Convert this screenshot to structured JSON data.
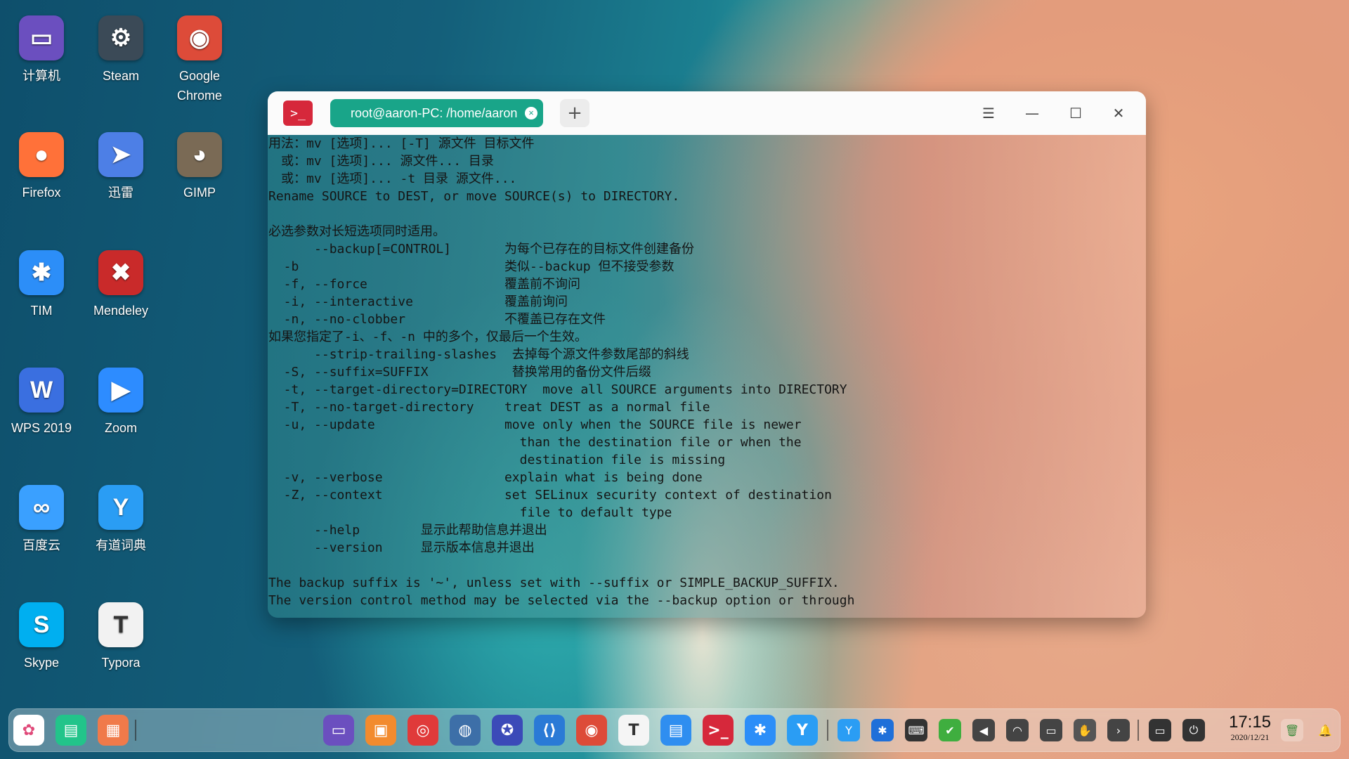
{
  "desktop": {
    "icons": [
      {
        "label": "计算机",
        "glyph": "▭",
        "color": "#6b4fbf",
        "icon": "computer-icon"
      },
      {
        "label": "Steam",
        "glyph": "⚙",
        "color": "#3b4a57",
        "icon": "steam-icon"
      },
      {
        "label": "Google Chrome",
        "glyph": "◉",
        "color": "#dd4b39",
        "icon": "chrome-icon"
      },
      {
        "label": "Firefox",
        "glyph": "●",
        "color": "#ff7139",
        "icon": "firefox-icon"
      },
      {
        "label": "迅雷",
        "glyph": "➤",
        "color": "#4d7fe6",
        "icon": "xunlei-icon"
      },
      {
        "label": "GIMP",
        "glyph": "◕",
        "color": "#7a6a55",
        "icon": "gimp-icon"
      },
      {
        "label": "TIM",
        "glyph": "✱",
        "color": "#2c8ef8",
        "icon": "tim-icon"
      },
      {
        "label": "Mendeley",
        "glyph": "✖",
        "color": "#c92a2a",
        "icon": "mendeley-icon"
      },
      {
        "label": "WPS 2019",
        "glyph": "W",
        "color": "#3a6fe0",
        "icon": "wps-icon"
      },
      {
        "label": "Zoom",
        "glyph": "▶",
        "color": "#2d8cff",
        "icon": "zoom-icon"
      },
      {
        "label": "百度云",
        "glyph": "∞",
        "color": "#3aa0ff",
        "icon": "baidu-cloud-icon"
      },
      {
        "label": "有道词典",
        "glyph": "Y",
        "color": "#2a9df4",
        "icon": "youdao-icon"
      },
      {
        "label": "Skype",
        "glyph": "S",
        "color": "#00aff0",
        "icon": "skype-icon"
      },
      {
        "label": "Typora",
        "glyph": "T",
        "color": "#f2f2f2",
        "icon": "typora-icon"
      }
    ]
  },
  "terminal": {
    "app_glyph": ">_",
    "tab_title": "root@aaron-PC: /home/aaron",
    "tab_close": "×",
    "new_tab": "+",
    "menu_glyph": "☰",
    "minimize_glyph": "—",
    "maximize_glyph": "☐",
    "close_glyph": "✕",
    "lines": [
      "用法：mv [选项]... [-T] 源文件 目标文件",
      "　或：mv [选项]... 源文件... 目录",
      "　或：mv [选项]... -t 目录 源文件...",
      "Rename SOURCE to DEST, or move SOURCE(s) to DIRECTORY.",
      "",
      "必选参数对长短选项同时适用。",
      "      --backup[=CONTROL]       为每个已存在的目标文件创建备份",
      "  -b                           类似--backup 但不接受参数",
      "  -f, --force                  覆盖前不询问",
      "  -i, --interactive            覆盖前询问",
      "  -n, --no-clobber             不覆盖已存在文件",
      "如果您指定了-i、-f、-n 中的多个，仅最后一个生效。",
      "      --strip-trailing-slashes  去掉每个源文件参数尾部的斜线",
      "  -S, --suffix=SUFFIX           替换常用的备份文件后缀",
      "  -t, --target-directory=DIRECTORY  move all SOURCE arguments into DIRECTORY",
      "  -T, --no-target-directory    treat DEST as a normal file",
      "  -u, --update                 move only when the SOURCE file is newer",
      "                                 than the destination file or when the",
      "                                 destination file is missing",
      "  -v, --verbose                explain what is being done",
      "  -Z, --context                set SELinux security context of destination",
      "                                 file to default type",
      "      --help        显示此帮助信息并退出",
      "      --version     显示版本信息并退出",
      "",
      "The backup suffix is '~', unless set with --suffix or SIMPLE_BACKUP_SUFFIX.",
      "The version control method may be selected via the --backup option or through"
    ]
  },
  "dock": {
    "left_apps": [
      {
        "glyph": "✿",
        "color": "#ffffff",
        "fg": "#e04a7a",
        "icon": "launcher-icon"
      },
      {
        "glyph": "▤",
        "color": "#22c48a",
        "fg": "#ffffff",
        "icon": "multitask-view-icon"
      },
      {
        "glyph": "▦",
        "color": "#f07a4a",
        "fg": "#ffffff",
        "icon": "app-store-icon"
      }
    ],
    "center_apps": [
      {
        "glyph": "▭",
        "color": "#6b4fbf",
        "icon": "computer-icon"
      },
      {
        "glyph": "▣",
        "color": "#f28b2e",
        "icon": "file-manager-icon"
      },
      {
        "glyph": "◎",
        "color": "#e03a3a",
        "icon": "netease-music-icon"
      },
      {
        "glyph": "◍",
        "color": "#3d6fa8",
        "icon": "thunderbird-icon"
      },
      {
        "glyph": "✪",
        "color": "#3b4ab8",
        "icon": "settings-icon"
      },
      {
        "glyph": "⟨⟩",
        "color": "#2a7ad6",
        "icon": "vscode-icon"
      },
      {
        "glyph": "◉",
        "color": "#dd4b39",
        "icon": "chrome-icon"
      },
      {
        "glyph": "T",
        "color": "#f5f5f5",
        "icon": "typora-icon"
      },
      {
        "glyph": "▤",
        "color": "#2f8ef0",
        "icon": "calendar-icon"
      },
      {
        "glyph": ">_",
        "color": "#d6283b",
        "icon": "terminal-icon"
      },
      {
        "glyph": "✱",
        "color": "#2c8ef8",
        "icon": "tim-icon"
      },
      {
        "glyph": "Y",
        "color": "#2a9df4",
        "icon": "youdao-icon"
      }
    ],
    "tray": [
      {
        "glyph": "Y",
        "color": "#2a9df4",
        "icon": "youdao-tray-icon"
      },
      {
        "glyph": "✱",
        "color": "#1e6fd9",
        "icon": "tim-tray-icon"
      },
      {
        "glyph": "⌨",
        "color": "#333333",
        "icon": "keyboard-icon"
      },
      {
        "glyph": "✔",
        "color": "#3fae3f",
        "icon": "check-icon"
      },
      {
        "glyph": "◀",
        "color": "#444444",
        "icon": "volume-icon"
      },
      {
        "glyph": "◠",
        "color": "#444444",
        "icon": "wifi-icon"
      },
      {
        "glyph": "▭",
        "color": "#444444",
        "icon": "battery-icon"
      },
      {
        "glyph": "✋",
        "color": "#555555",
        "icon": "fingerprint-icon"
      },
      {
        "glyph": "›",
        "color": "#444444",
        "icon": "chevron-right-icon"
      }
    ],
    "system": [
      {
        "glyph": "▭",
        "color": "#333333",
        "icon": "show-desktop-icon"
      },
      {
        "glyph": "⏻",
        "color": "#333333",
        "icon": "power-icon"
      }
    ],
    "clock_time": "17:15",
    "clock_date": "2020/12/21",
    "trash_glyph": "🗑",
    "bell_glyph": "🔔"
  }
}
